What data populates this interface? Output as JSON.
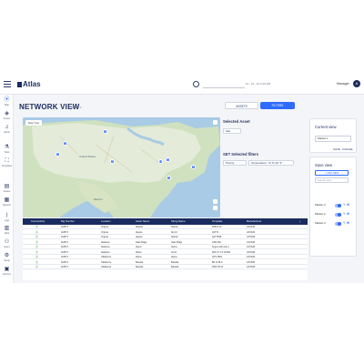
{
  "app": {
    "logo": "Atlas",
    "search_meta": "11 - 10 - 22 2:46 AM",
    "user_name": "Manager",
    "avatar_initial": "A"
  },
  "rail": {
    "items": [
      {
        "label": "Map",
        "icon": "map-pin-icon"
      },
      {
        "label": "Assets",
        "icon": "tag-icon"
      },
      {
        "label": "Alerts",
        "icon": "bell-icon"
      },
      {
        "label": "Tests",
        "icon": "flask-icon"
      },
      {
        "label": "Templates",
        "icon": "layers-icon"
      },
      {
        "label": "Assets",
        "icon": "document-icon"
      },
      {
        "label": "Reports",
        "icon": "chart-icon"
      },
      {
        "label": "Logs",
        "icon": "terminal-icon"
      },
      {
        "label": "Data",
        "icon": "database-icon"
      },
      {
        "label": "Users",
        "icon": "users-icon"
      },
      {
        "label": "Setup",
        "icon": "gear-icon"
      },
      {
        "label": "Devices",
        "icon": "device-icon"
      },
      {
        "label": "Settings",
        "icon": "wrench-icon"
      }
    ]
  },
  "main": {
    "title": "NETWORK VIEW",
    "breadcrumb": "Market 1",
    "tab_assets": "ASSETS",
    "tab_filters": "FILTERS",
    "map_type": "Map Type",
    "map_labels": [
      "United States",
      "Mexico"
    ],
    "clusters": [
      "6",
      "3",
      "4",
      "12",
      "8",
      "5",
      "3",
      "2"
    ],
    "selected_asset": {
      "title": "Selected Asset",
      "value": "Site"
    },
    "selected_filters": {
      "title": "SET Selected filters",
      "chips": [
        "Priority",
        "Temperature: 74 To 94 °F"
      ]
    }
  },
  "current_view": {
    "title": "Current view",
    "value": "Market 1",
    "save": "SAVE",
    "cancel": "CANCEL"
  },
  "save_view": {
    "title": "Save view",
    "add": "+ ADD NEW",
    "search_placeholder": "Search view",
    "rows": [
      "Market 3",
      "Market 2",
      "Market 3"
    ]
  },
  "table": {
    "columns": [
      "Connectivity",
      "Rig Number",
      "Location",
      "Asset Name",
      "String Name",
      "Template",
      "Manufacturer"
    ],
    "rows": [
      [
        "",
        "118573",
        "Virginia",
        "Albania",
        "Atlantic",
        "2P6X1 16",
        "AXXIUM"
      ],
      [
        "",
        "118573",
        "Virginia",
        "Algeria",
        "Alp 10",
        "QLT72",
        "AXXIUM"
      ],
      [
        "",
        "118573",
        "Virginia",
        "Algeria",
        "Atlantic",
        "QLTTS98",
        "AXXIUM"
      ],
      [
        "",
        "118573",
        "Alabama",
        "Atlas Ridge",
        "Atlas Ridge",
        "AXM 160",
        "AXXIUM"
      ],
      [
        "",
        "118573",
        "Alabama",
        "Alpine",
        "Alpine",
        "Angus with side 4",
        "AXXIUM"
      ],
      [
        "",
        "118573",
        "Alabama",
        "Alpine",
        "Arrow",
        "2DF 27-7-6 10:500",
        "AXXIUM"
      ],
      [
        "",
        "118573",
        "Oklahoma",
        "Alpine",
        "Alpine",
        "QTS 3606",
        "AXXIUM"
      ],
      [
        "",
        "118573",
        "Oklahoma",
        "Banada",
        "Banada",
        "BP 11 BLC",
        "AXXIUM"
      ],
      [
        "",
        "118573",
        "Oklahoma",
        "Banada",
        "Banada",
        "3500 XP M",
        "AXXIUM"
      ]
    ]
  },
  "colors": {
    "primary": "#2e6bff",
    "navy": "#1a2b5f",
    "connected": "#3a9a3a"
  }
}
